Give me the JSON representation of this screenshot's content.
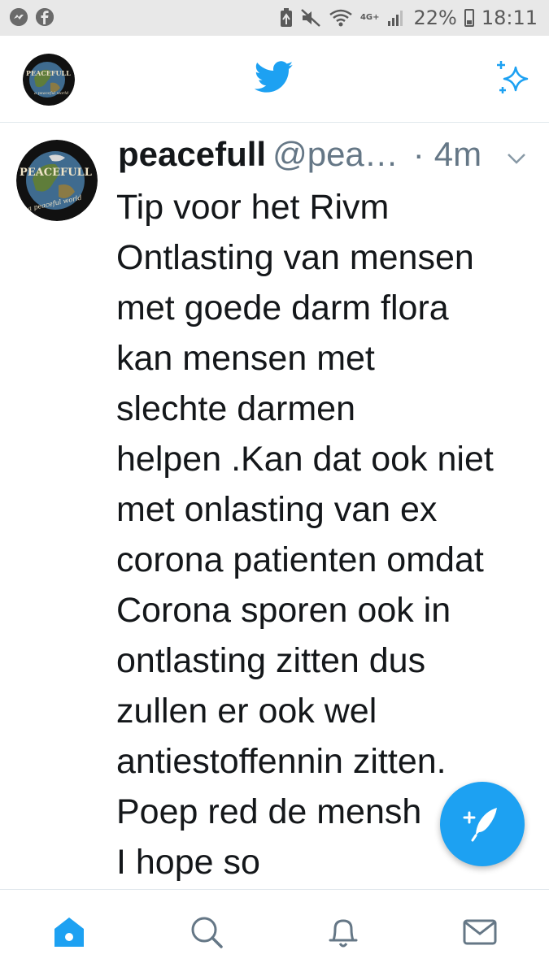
{
  "status_bar": {
    "time": "18:11",
    "battery": "22%",
    "network": "4G+",
    "left_icons": [
      "messenger-icon",
      "facebook-icon"
    ],
    "right_icons": [
      "battery-saver-icon",
      "mute-icon",
      "wifi-icon",
      "signal-icon",
      "battery-icon"
    ]
  },
  "top_bar": {
    "profile_icon": "avatar",
    "center_icon": "twitter-bird-icon",
    "right_icon": "sparkle-icon"
  },
  "tweet": {
    "display_name": "peacefull",
    "handle": "@pea…",
    "separator": "·",
    "time": "4m",
    "avatar_text_top": "PEACEFULL",
    "avatar_text_bottom": "a peaceful world",
    "lines": [
      "Tip voor het Rivm",
      "Ontlasting van mensen",
      "met goede darm flora",
      "kan mensen met",
      "slechte darmen",
      "helpen .Kan dat ook niet",
      "met onlasting van ex",
      "corona patienten omdat",
      "Corona sporen ook in",
      "ontlasting zitten dus",
      "zullen er ook wel",
      "antiestoffennin zitten.",
      "Poep red de mensh",
      "I hope so"
    ]
  },
  "fab": {
    "icon": "compose-icon"
  },
  "bottom_nav": [
    "home-icon",
    "search-icon",
    "notifications-icon",
    "messages-icon"
  ],
  "colors": {
    "accent": "#1da1f2",
    "text": "#14171a",
    "muted": "#657786",
    "divider": "#e1e8ed"
  }
}
